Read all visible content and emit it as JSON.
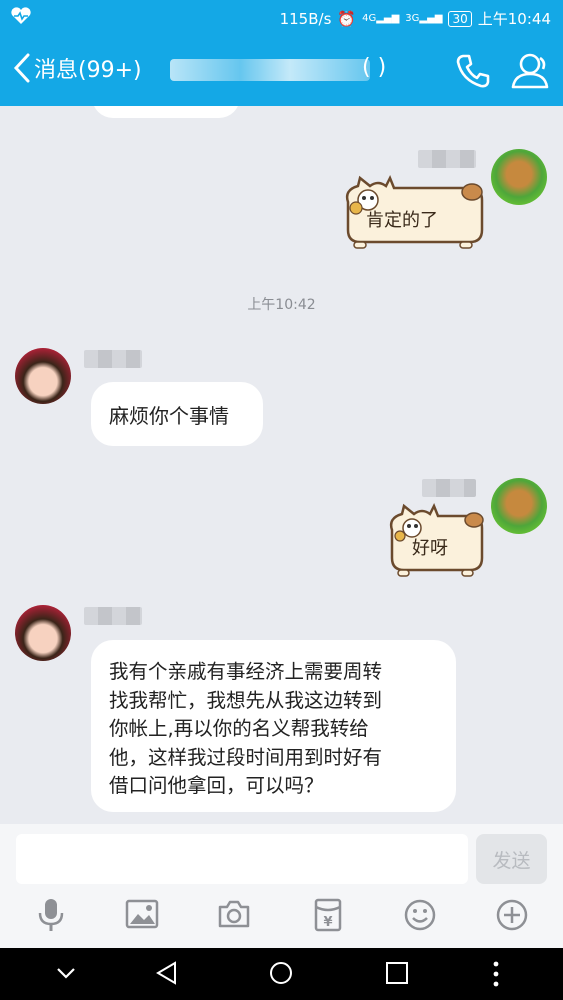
{
  "status_bar": {
    "network_speed": "115B/s",
    "signal_1": "4G",
    "signal_2": "3G",
    "battery": "30",
    "time": "上午10:44"
  },
  "header": {
    "back_label": "消息(99+)",
    "title_suffix": "( )"
  },
  "chat": {
    "timestamp": "上午10:42",
    "messages": [
      {
        "side": "right",
        "type": "sticker",
        "text": "肯定的了"
      },
      {
        "side": "left",
        "type": "text",
        "text": "麻烦你个事情"
      },
      {
        "side": "right",
        "type": "sticker",
        "text": "好呀"
      },
      {
        "side": "left",
        "type": "text",
        "lines": [
          "我有个亲戚有事经济上需要周转",
          "找我帮忙，我想先从我这边转到",
          "你帐上,再以你的名义帮我转给",
          "他，这样我过段时间用到时好有",
          "借口问他拿回，可以吗？"
        ]
      }
    ]
  },
  "input": {
    "placeholder": "",
    "send_label": "发送"
  },
  "toolbar": [
    "microphone-icon",
    "image-icon",
    "camera-icon",
    "red-packet-icon",
    "emoji-icon",
    "plus-icon"
  ],
  "colors": {
    "brand": "#14a8e6",
    "chat_bg": "#e9ebf0"
  }
}
